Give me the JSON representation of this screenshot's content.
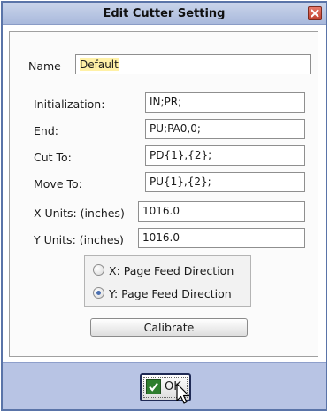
{
  "window": {
    "title": "Edit Cutter Setting",
    "close_icon": "close-icon"
  },
  "form": {
    "name_label": "Name",
    "name_value": "Default",
    "fields": [
      {
        "label": "Initialization:",
        "value": "IN;PR;"
      },
      {
        "label": "End:",
        "value": "PU;PA0,0;"
      },
      {
        "label": "Cut To:",
        "value": "PD{1},{2};"
      },
      {
        "label": "Move To:",
        "value": "PU{1},{2};"
      },
      {
        "label": "X Units: (inches)",
        "value": "1016.0"
      },
      {
        "label": "Y Units: (inches)",
        "value": "1016.0"
      }
    ]
  },
  "page_feed": {
    "options": [
      {
        "label": "X: Page Feed Direction",
        "selected": false
      },
      {
        "label": "Y: Page Feed Direction",
        "selected": true
      }
    ]
  },
  "buttons": {
    "calibrate": "Calibrate",
    "ok": "OK",
    "ok_icon": "check-icon"
  },
  "colors": {
    "accent": "#4a6fb0",
    "title_bar": "#b4c2e2",
    "footer": "#b8c4e4",
    "name_highlight": "#fff1a6",
    "ok_check": "#2f7e2f"
  }
}
